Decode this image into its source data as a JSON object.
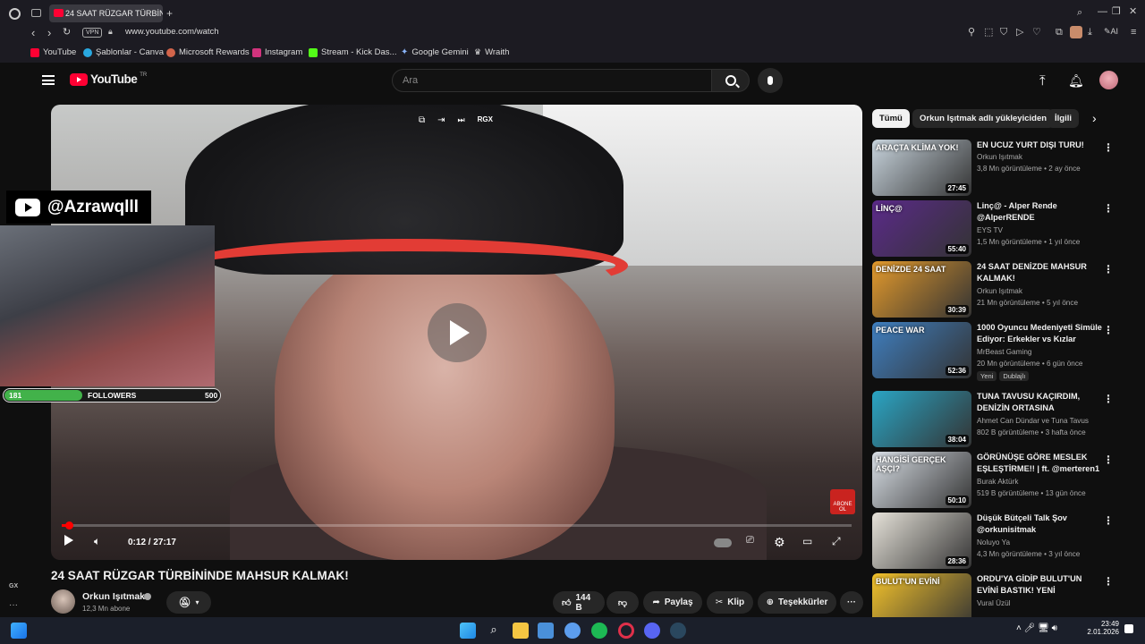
{
  "browser": {
    "tab_title": "24 SAAT RÜZGAR TÜRBİNİ",
    "vpn": "VPN",
    "url": "www.youtube.com/watch",
    "ai": "AI",
    "bookmarks": [
      "YouTube",
      "Şablonlar - Canva",
      "Microsoft Rewards",
      "Instagram",
      "Stream - Kick Das...",
      "Google Gemini",
      "Wraith"
    ]
  },
  "sidebar": {
    "gx": "GX",
    "more": "···"
  },
  "youtube": {
    "logo": "YouTube",
    "logo_tr": "TR",
    "search_placeholder": "Ara"
  },
  "player": {
    "top_label": "RGX",
    "time": "0:12 / 27:17",
    "progress_fraction": 0.007,
    "abone": "ABONE OL"
  },
  "overlay": {
    "handle": "@Azrawqlll",
    "followers_start": "181",
    "followers_label": "FOLLOWERS",
    "followers_goal": "500",
    "followers_fraction": 0.36
  },
  "video": {
    "title": "24 SAAT RÜZGAR TÜRBİNİNDE MAHSUR KALMAK!",
    "channel": "Orkun Işıtmak",
    "subs": "12,3 Mn abone",
    "likes": "144 B",
    "share": "Paylaş",
    "clip": "Klip",
    "thanks": "Teşekkürler"
  },
  "chips": [
    "Tümü",
    "Orkun Işıtmak adlı yükleyiciden",
    "İlgili"
  ],
  "recommendations": [
    {
      "title": "EN UCUZ YURT DIŞI TURU!",
      "channel": "Orkun Işıtmak",
      "meta": "3,8 Mn görüntüleme • 2 ay önce",
      "duration": "27:45",
      "thumb_text": "ARAÇTA KLİMA YOK!",
      "color": "#c8d4dd"
    },
    {
      "title": "Linç@ - Alper Rende @AlperRENDE",
      "channel": "EYS TV",
      "meta": "1,5 Mn görüntüleme • 1 yıl önce",
      "duration": "55:40",
      "thumb_text": "LİNÇ@",
      "color": "#5b2a8a"
    },
    {
      "title": "24 SAAT DENİZDE MAHSUR KALMAK!",
      "channel": "Orkun Işıtmak",
      "meta": "21 Mn görüntüleme • 5 yıl önce",
      "duration": "30:39",
      "thumb_text": "DENİZDE 24 SAAT",
      "color": "#e39a2c"
    },
    {
      "title": "1000 Oyuncu Medeniyeti Simüle Ediyor: Erkekler vs Kızlar",
      "channel": "MrBeast Gaming",
      "meta": "20 Mn görüntüleme • 6 gün önce",
      "duration": "52:36",
      "thumb_text": "PEACE WAR",
      "color": "#3f7fc0",
      "tags": [
        "Yeni",
        "Dublajlı"
      ]
    },
    {
      "title": "TUNA TAVUSU KAÇIRDIM, DENİZİN ORTASINA BIRAKTIM...",
      "channel": "Ahmet Can Dündar ve Tuna Tavus",
      "meta": "802 B görüntüleme • 3 hafta önce",
      "duration": "38:04",
      "thumb_text": "",
      "color": "#2aa5c4"
    },
    {
      "title": "GÖRÜNÜŞE GÖRE MESLEK EŞLEŞTİRME!! | ft. @merteren1",
      "channel": "Burak Aktürk",
      "meta": "519 B görüntüleme • 13 gün önce",
      "duration": "50:10",
      "thumb_text": "HANGİSİ GERÇEK AŞÇI?",
      "color": "#d9dfe6"
    },
    {
      "title": "Düşük Bütçeli Talk Şov @orkunisitmak",
      "channel": "Noluyo Ya",
      "meta": "4,3 Mn görüntüleme • 3 yıl önce",
      "duration": "28:36",
      "thumb_text": "",
      "color": "#e6e2d9"
    },
    {
      "title": "ORDU'YA GİDİP BULUT'UN EVİNİ BASTIK! YENİ BİLGİSAYAR ...",
      "channel": "Vural Üzül",
      "meta": "",
      "duration": "",
      "thumb_text": "BULUT'UN EVİNİ",
      "color": "#f3c22b"
    }
  ],
  "taskbar": {
    "time": "23:49",
    "date": "2.01.2026"
  }
}
